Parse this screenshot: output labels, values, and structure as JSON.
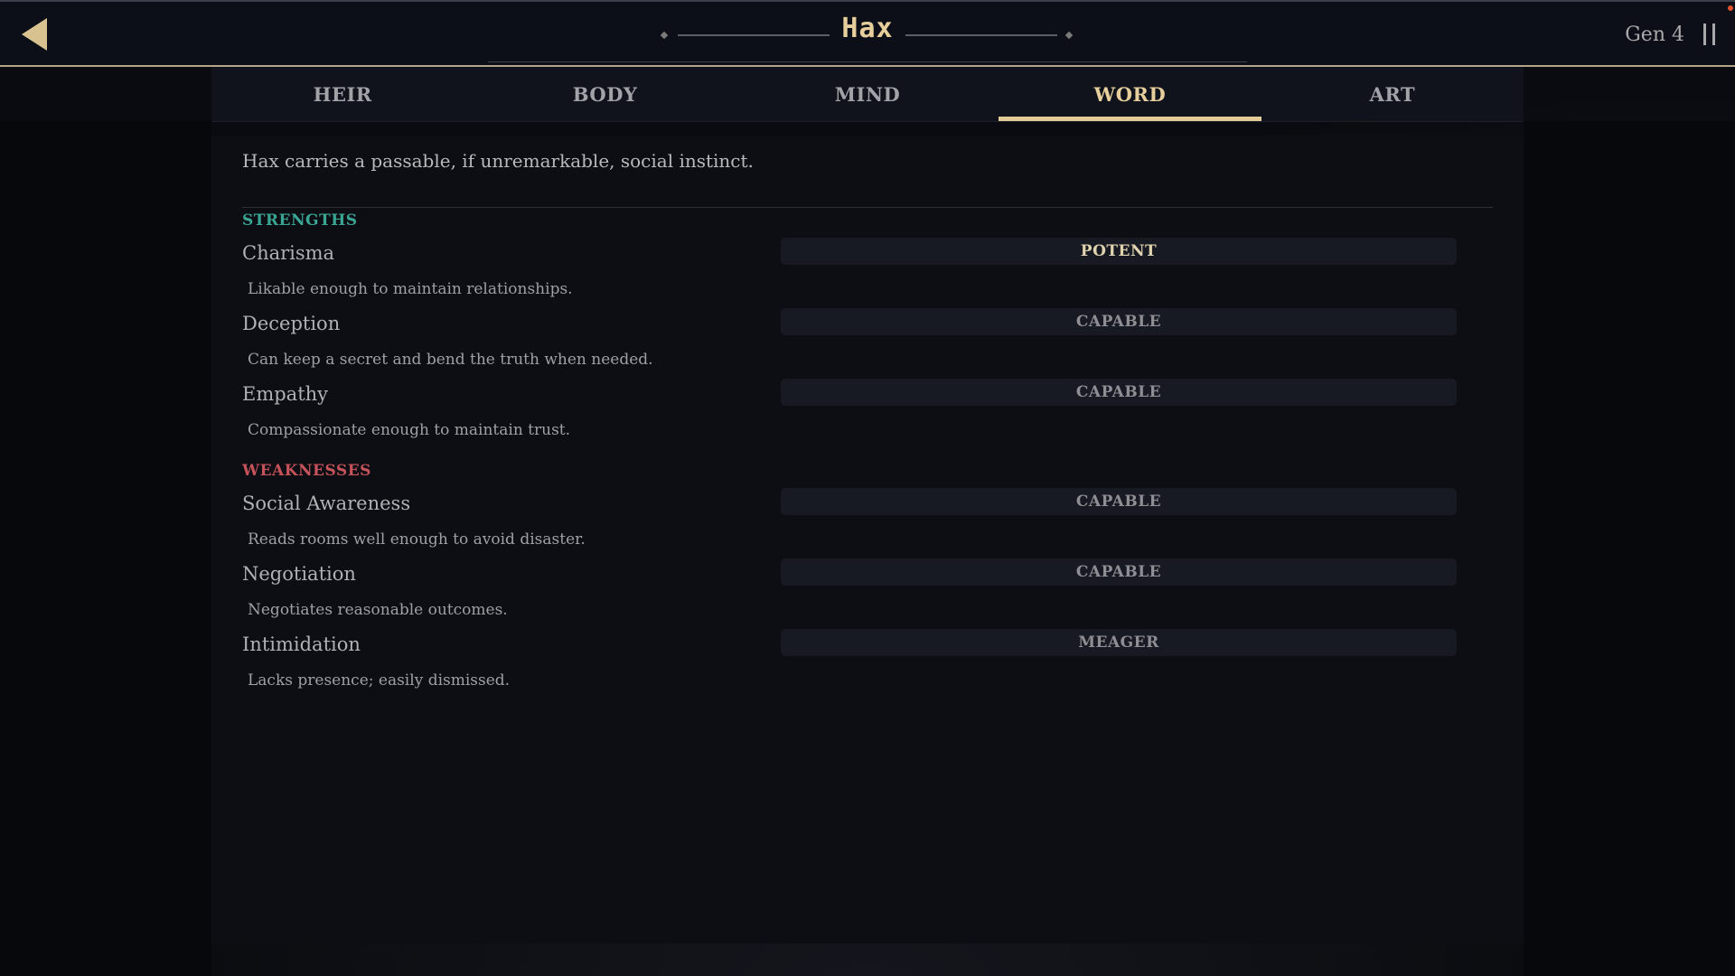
{
  "header": {
    "back_icon": "back-arrow-icon",
    "title": "Hax",
    "generation": "Gen 4",
    "pause_icon": "pause-icon"
  },
  "tabs": [
    {
      "label": "HEIR",
      "active": false
    },
    {
      "label": "BODY",
      "active": false
    },
    {
      "label": "MIND",
      "active": false
    },
    {
      "label": "WORD",
      "active": true
    },
    {
      "label": "ART",
      "active": false
    }
  ],
  "panel": {
    "summary": "Hax carries a passable, if unremarkable, social instinct.",
    "strengths_label": "STRENGTHS",
    "weaknesses_label": "WEAKNESSES",
    "strengths": [
      {
        "name": "Charisma",
        "description": "Likable enough to maintain relationships.",
        "rating": "POTENT"
      },
      {
        "name": "Deception",
        "description": "Can keep a secret and bend the truth when needed.",
        "rating": "CAPABLE"
      },
      {
        "name": "Empathy",
        "description": "Compassionate enough to maintain trust.",
        "rating": "CAPABLE"
      }
    ],
    "weaknesses": [
      {
        "name": "Social Awareness",
        "description": "Reads rooms well enough to avoid disaster.",
        "rating": "CAPABLE"
      },
      {
        "name": "Negotiation",
        "description": "Negotiates reasonable outcomes.",
        "rating": "CAPABLE"
      },
      {
        "name": "Intimidation",
        "description": "Lacks presence; easily dismissed.",
        "rating": "MEAGER"
      }
    ]
  },
  "colors": {
    "accent_gold": "#e3cb98",
    "strengths_teal": "#3aa593",
    "weaknesses_red": "#c6525a"
  }
}
